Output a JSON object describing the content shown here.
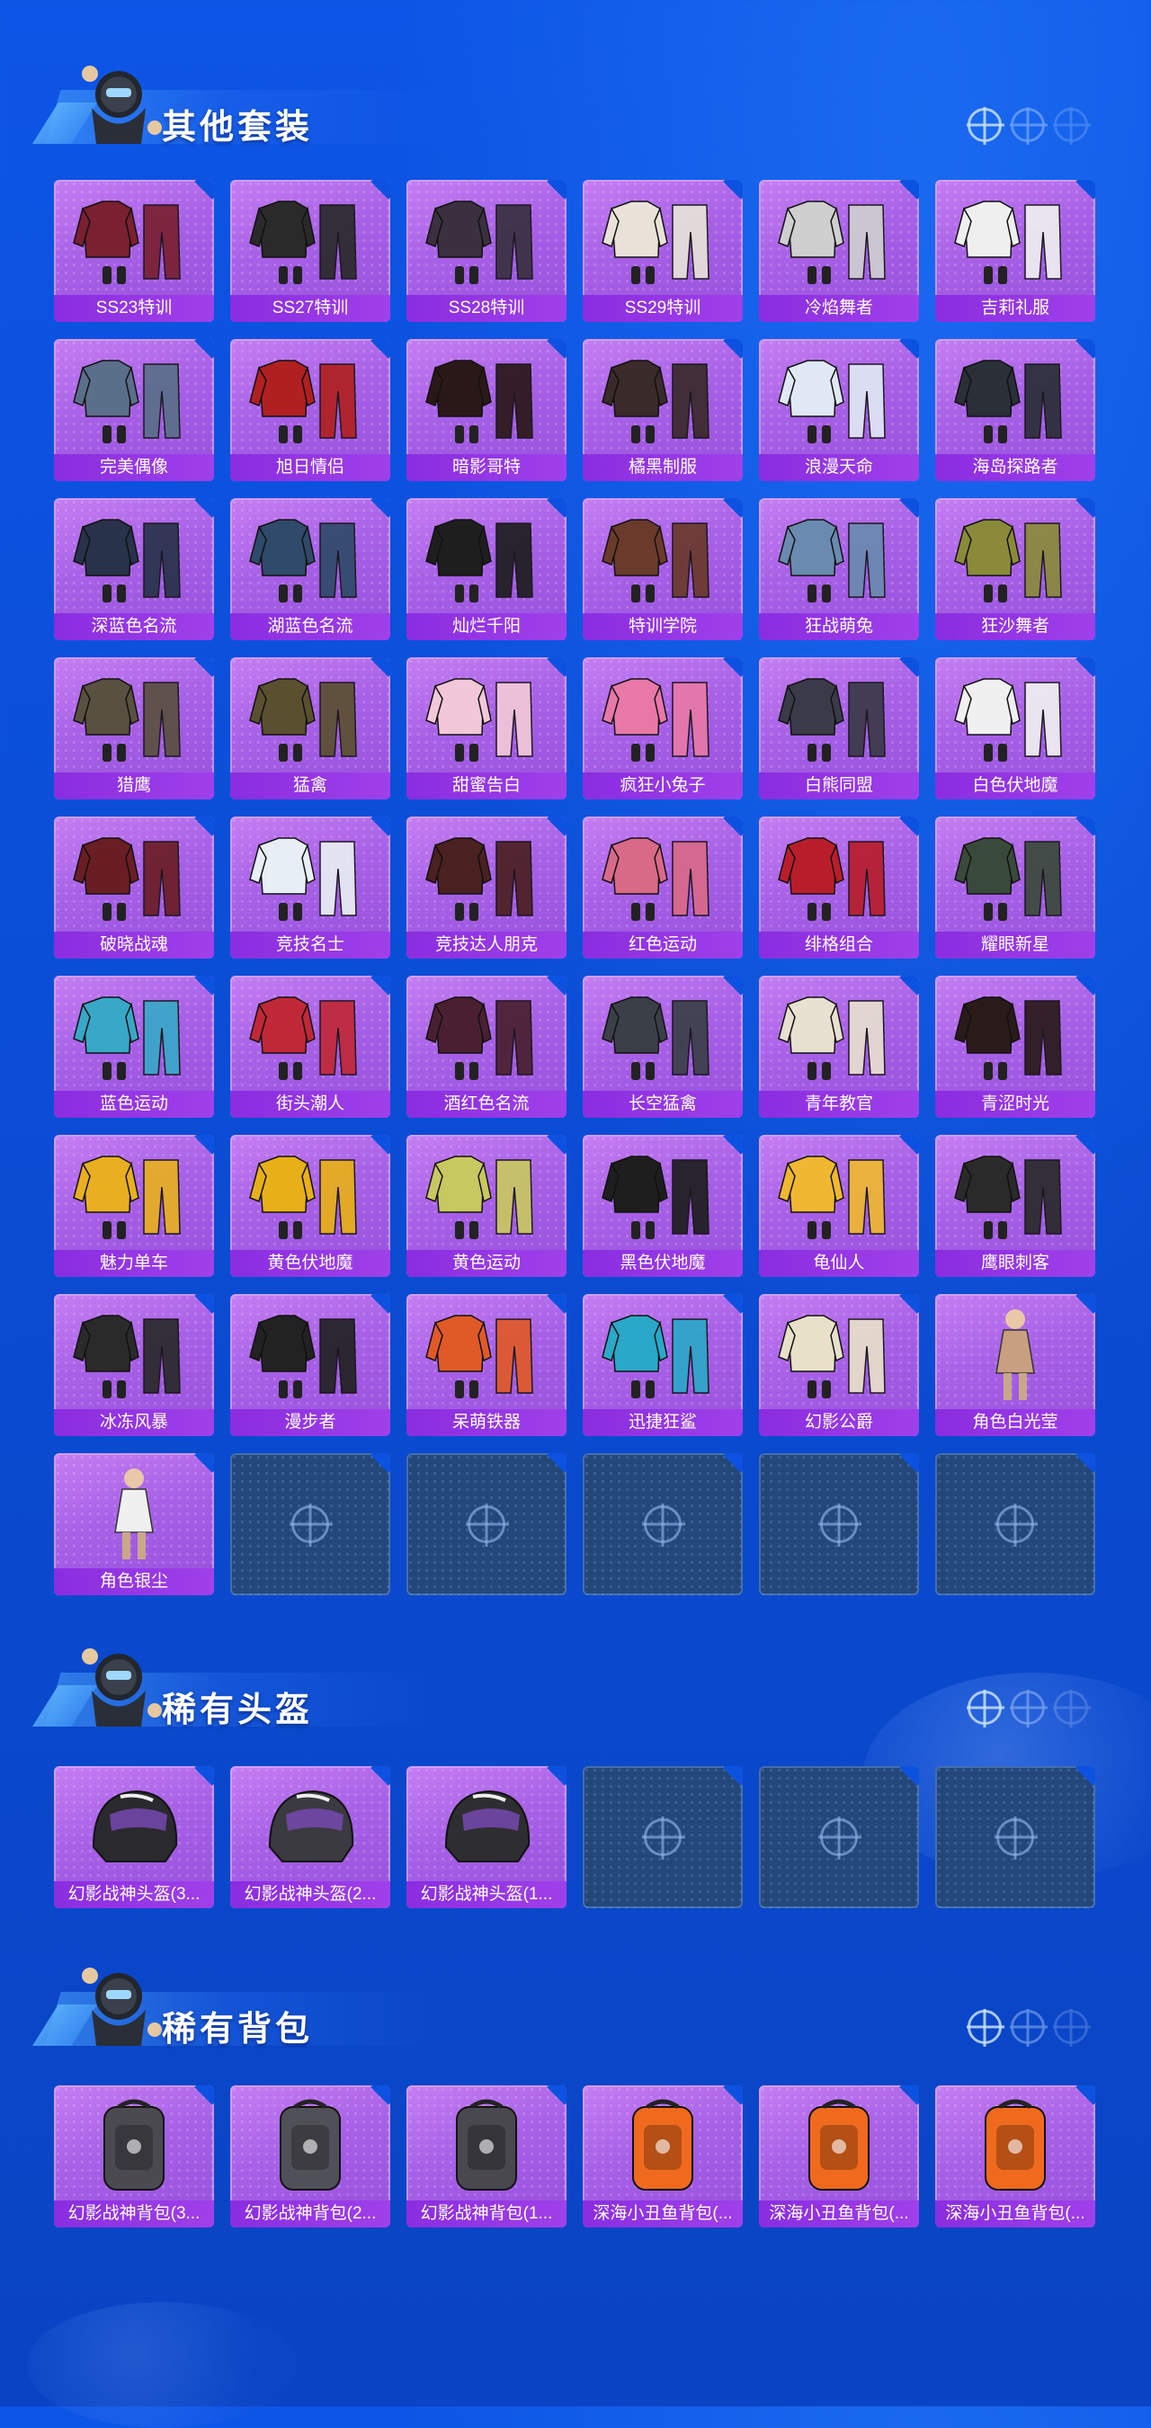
{
  "sections": [
    {
      "title": "其他套装",
      "items": [
        {
          "label": "SS23特训",
          "icon": "outfit-icon",
          "color": "#7a2030"
        },
        {
          "label": "SS27特训",
          "icon": "outfit-icon",
          "color": "#2a2a2a"
        },
        {
          "label": "SS28特训",
          "icon": "outfit-icon",
          "color": "#3a3040"
        },
        {
          "label": "SS29特训",
          "icon": "outfit-icon",
          "color": "#e8e2d8"
        },
        {
          "label": "冷焰舞者",
          "icon": "outfit-icon",
          "color": "#cfcfcf"
        },
        {
          "label": "吉莉礼服",
          "icon": "outfit-icon",
          "color": "#efefef"
        },
        {
          "label": "完美偶像",
          "icon": "outfit-icon",
          "color": "#5a6f8a"
        },
        {
          "label": "旭日情侣",
          "icon": "outfit-icon",
          "color": "#b02020"
        },
        {
          "label": "暗影哥特",
          "icon": "outfit-icon",
          "color": "#2a1818"
        },
        {
          "label": "橘黑制服",
          "icon": "outfit-icon",
          "color": "#3a2a2a"
        },
        {
          "label": "浪漫天命",
          "icon": "outfit-icon",
          "color": "#e0e8f5"
        },
        {
          "label": "海岛探路者",
          "icon": "outfit-icon",
          "color": "#2a2f38"
        },
        {
          "label": "深蓝色名流",
          "icon": "outfit-icon",
          "color": "#28324a"
        },
        {
          "label": "湖蓝色名流",
          "icon": "outfit-icon",
          "color": "#2f4a6a"
        },
        {
          "label": "灿烂千阳",
          "icon": "outfit-icon",
          "color": "#1e1e1e"
        },
        {
          "label": "特训学院",
          "icon": "outfit-icon",
          "color": "#6a3a2a"
        },
        {
          "label": "狂战萌兔",
          "icon": "outfit-icon",
          "color": "#6a8ab0"
        },
        {
          "label": "狂沙舞者",
          "icon": "outfit-icon",
          "color": "#8a8a3a"
        },
        {
          "label": "猎鹰",
          "icon": "outfit-icon",
          "color": "#5a5040"
        },
        {
          "label": "猛禽",
          "icon": "outfit-icon",
          "color": "#5a5030"
        },
        {
          "label": "甜蜜告白",
          "icon": "outfit-icon",
          "color": "#f2c8d8"
        },
        {
          "label": "疯狂小兔子",
          "icon": "outfit-icon",
          "color": "#e878a8"
        },
        {
          "label": "白熊同盟",
          "icon": "outfit-icon",
          "color": "#3a3a48"
        },
        {
          "label": "白色伏地魔",
          "icon": "outfit-icon",
          "color": "#f0f0f0"
        },
        {
          "label": "破晓战魂",
          "icon": "outfit-icon",
          "color": "#6a1e24"
        },
        {
          "label": "竞技名士",
          "icon": "outfit-icon",
          "color": "#e8eef5"
        },
        {
          "label": "竞技达人朋克",
          "icon": "outfit-icon",
          "color": "#4a2020"
        },
        {
          "label": "红色运动",
          "icon": "outfit-icon",
          "color": "#d86a88"
        },
        {
          "label": "绯格组合",
          "icon": "outfit-icon",
          "color": "#b81e2a"
        },
        {
          "label": "耀眼新星",
          "icon": "outfit-icon",
          "color": "#3a4a3a"
        },
        {
          "label": "蓝色运动",
          "icon": "outfit-icon",
          "color": "#38a8c8"
        },
        {
          "label": "街头潮人",
          "icon": "outfit-icon",
          "color": "#c02838"
        },
        {
          "label": "酒红色名流",
          "icon": "outfit-icon",
          "color": "#4a2030"
        },
        {
          "label": "长空猛禽",
          "icon": "outfit-icon",
          "color": "#3a3f48"
        },
        {
          "label": "青年教官",
          "icon": "outfit-icon",
          "color": "#e8e0d0"
        },
        {
          "label": "青涩时光",
          "icon": "outfit-icon",
          "color": "#2a1a1a"
        },
        {
          "label": "魅力单车",
          "icon": "outfit-icon",
          "color": "#e8b020"
        },
        {
          "label": "黄色伏地魔",
          "icon": "outfit-icon",
          "color": "#e8b018"
        },
        {
          "label": "黄色运动",
          "icon": "outfit-icon",
          "color": "#c8c860"
        },
        {
          "label": "黑色伏地魔",
          "icon": "outfit-icon",
          "color": "#1e1e1e"
        },
        {
          "label": "龟仙人",
          "icon": "outfit-icon",
          "color": "#f0b830"
        },
        {
          "label": "鹰眼刺客",
          "icon": "outfit-icon",
          "color": "#2a2a2a"
        },
        {
          "label": "冰冻风暴",
          "icon": "outfit-icon",
          "color": "#2a2a2a"
        },
        {
          "label": "漫步者",
          "icon": "outfit-icon",
          "color": "#222222"
        },
        {
          "label": "呆萌铁器",
          "icon": "outfit-icon",
          "color": "#e05a28"
        },
        {
          "label": "迅捷狂鲨",
          "icon": "outfit-icon",
          "color": "#2aa8c8"
        },
        {
          "label": "幻影公爵",
          "icon": "outfit-icon",
          "color": "#e8e0c8"
        },
        {
          "label": "角色白光莹",
          "icon": "character-icon",
          "color": "#c8a080"
        },
        {
          "label": "角色银尘",
          "icon": "character-icon",
          "color": "#f0f0f0"
        }
      ],
      "empty_slots": 5
    },
    {
      "title": "稀有头盔",
      "items": [
        {
          "label": "幻影战神头盔(3...",
          "icon": "helmet-icon",
          "color": "#2a2a2e"
        },
        {
          "label": "幻影战神头盔(2...",
          "icon": "helmet-icon",
          "color": "#3a3a40"
        },
        {
          "label": "幻影战神头盔(1...",
          "icon": "helmet-icon",
          "color": "#2e2e30"
        }
      ],
      "empty_slots": 3
    },
    {
      "title": "稀有背包",
      "items": [
        {
          "label": "幻影战神背包(3...",
          "icon": "backpack-icon",
          "color": "#4a4a50"
        },
        {
          "label": "幻影战神背包(2...",
          "icon": "backpack-icon",
          "color": "#505058"
        },
        {
          "label": "幻影战神背包(1...",
          "icon": "backpack-icon",
          "color": "#48484e"
        },
        {
          "label": "深海小丑鱼背包(...",
          "icon": "backpack-icon",
          "color": "#f06a1e"
        },
        {
          "label": "深海小丑鱼背包(...",
          "icon": "backpack-icon",
          "color": "#f06a1e"
        },
        {
          "label": "深海小丑鱼背包(...",
          "icon": "backpack-icon",
          "color": "#f06a1e"
        }
      ],
      "empty_slots": 0
    }
  ]
}
